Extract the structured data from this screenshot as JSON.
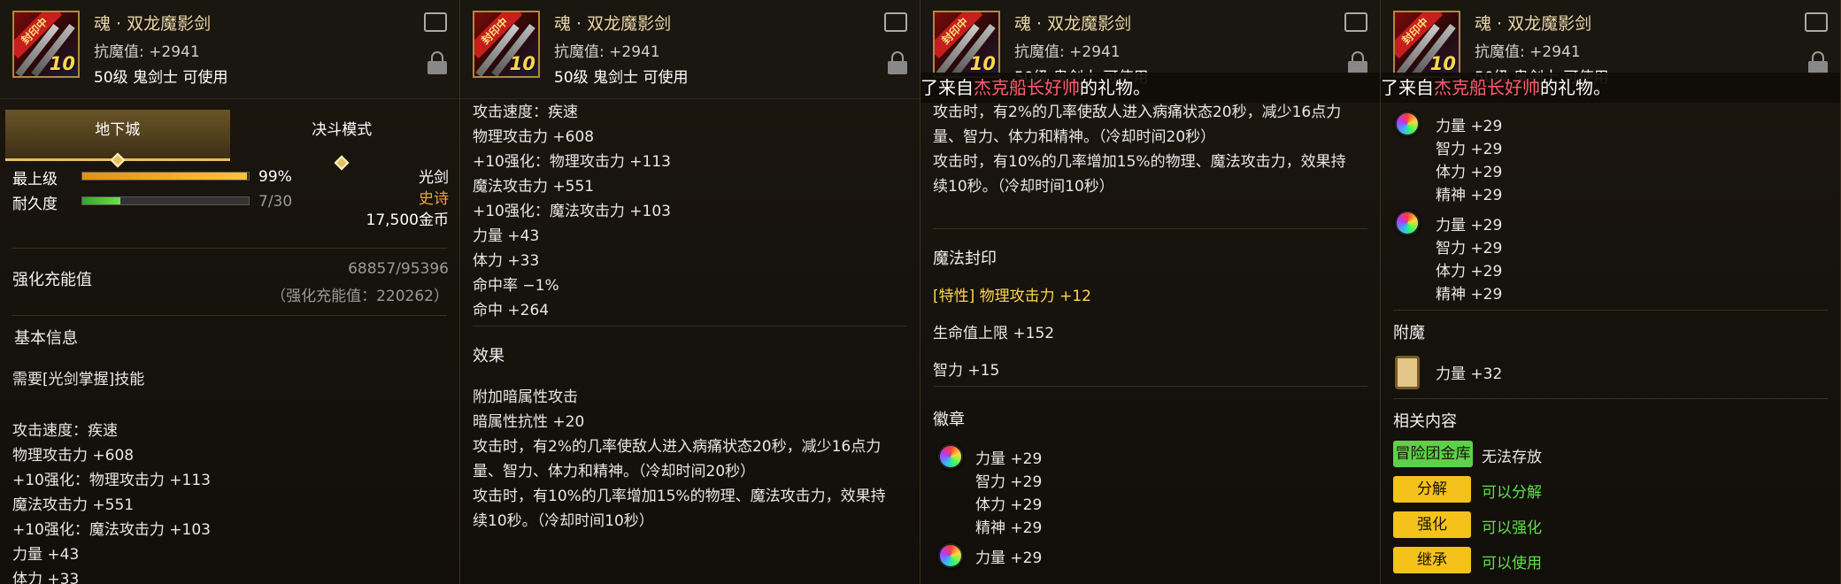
{
  "item": {
    "badge": "封印中",
    "level_num": "10",
    "name": "魂 · 双龙魔影剑",
    "resist": "抗魔值: +2941",
    "requirement": "50级 鬼剑士 可使用"
  },
  "panel1": {
    "tabs": [
      "地下城",
      "决斗模式"
    ],
    "grade_label": "最上级",
    "grade_value": "99%",
    "durability_label": "耐久度",
    "durability_value": "7/30",
    "weapon_type": "光剑",
    "rarity": "史诗",
    "price": "17,500金币",
    "charge_label": "强化充能值",
    "charge_value": "68857/95396",
    "charge_sub": "（强化充能值：220262）",
    "basic_info": "基本信息",
    "skill_req": "需要[光剑掌握]技能",
    "stats": [
      "攻击速度：疾速",
      "物理攻击力 +608",
      "+10强化：物理攻击力 +113",
      "魔法攻击力 +551",
      "+10强化：魔法攻击力 +103",
      "力量 +43",
      "体力 +33"
    ]
  },
  "panel2": {
    "stats": [
      "攻击速度：疾速",
      "物理攻击力 +608",
      "+10强化：物理攻击力 +113",
      "魔法攻击力 +551",
      "+10强化：魔法攻击力 +103",
      "力量 +43",
      "体力 +33",
      "命中率 −1%",
      "命中 +264"
    ],
    "effect_title": "效果",
    "effects": [
      "附加暗属性攻击",
      "暗属性抗性 +20",
      "攻击时，有2%的几率使敌人进入病痛状态20秒，减少16点力",
      "量、智力、体力和精神。（冷却时间20秒）",
      "攻击时，有10%的几率增加15%的物理、魔法攻击力，效果持",
      "续10秒。（冷却时间10秒）"
    ]
  },
  "panel3": {
    "banner_pre": "了来自",
    "banner_name": "杰克船长好帅",
    "banner_post": "的礼物。",
    "effects": [
      "攻击时，有2%的几率使敌人进入病痛状态20秒，减少16点力",
      "量、智力、体力和精神。（冷却时间20秒）",
      "攻击时，有10%的几率增加15%的物理、魔法攻击力，效果持",
      "续10秒。（冷却时间10秒）"
    ],
    "seal_title": "魔法封印",
    "seal_trait": "[特性] 物理攻击力 +12",
    "seal_hp": "生命值上限 +152",
    "seal_int": "智力 +15",
    "emblem_title": "徽章",
    "emblem1": [
      "力量 +29",
      "智力 +29",
      "体力 +29",
      "精神 +29"
    ],
    "emblem2_first": "力量 +29"
  },
  "panel4": {
    "banner_pre": "了来自",
    "banner_name": "杰克船长好帅",
    "banner_post": "的礼物。",
    "emblem1": [
      "力量 +29",
      "智力 +29",
      "体力 +29",
      "精神 +29"
    ],
    "emblem2": [
      "力量 +29",
      "智力 +29",
      "体力 +29",
      "精神 +29"
    ],
    "enchant_title": "附魔",
    "enchant_value": "力量 +32",
    "related_title": "相关内容",
    "related": [
      {
        "btn": "冒险团金库",
        "text": "无法存放"
      },
      {
        "btn": "分解",
        "text": "可以分解"
      },
      {
        "btn": "强化",
        "text": "可以强化"
      },
      {
        "btn": "继承",
        "text": "可以使用"
      }
    ]
  }
}
